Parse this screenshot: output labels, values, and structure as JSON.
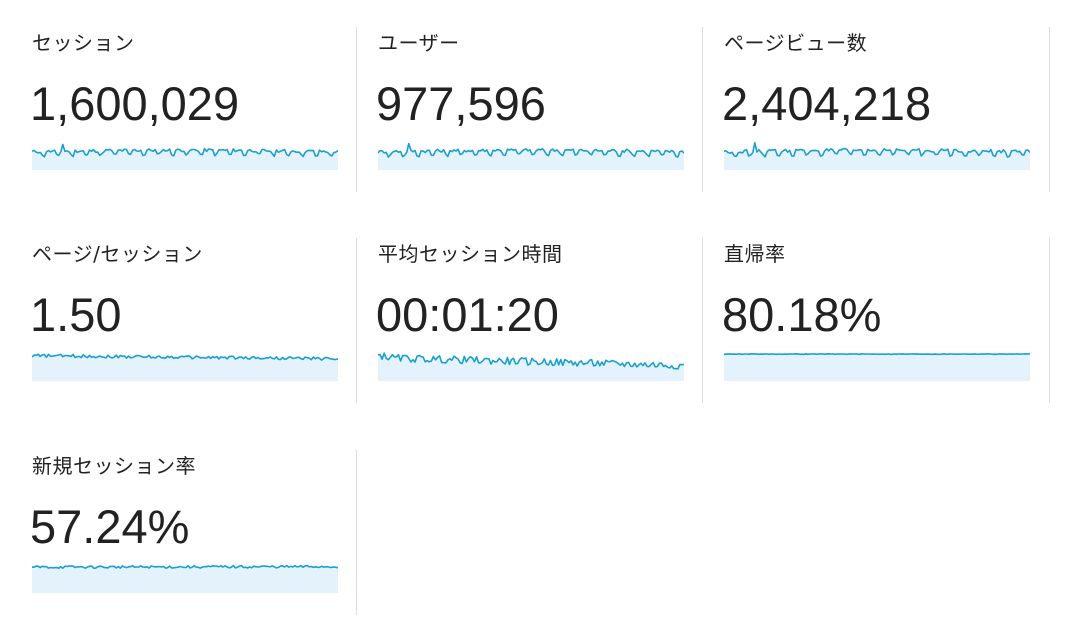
{
  "accent": "#1a9fd1",
  "fill": "#e4f3fb",
  "metrics": [
    {
      "label": "セッション",
      "value": "1,600,029",
      "trend": {
        "shape": "seasonal",
        "base": 0.45,
        "amp": 0.28,
        "spike": 0.12,
        "rise": 0.06
      }
    },
    {
      "label": "ユーザー",
      "value": "977,596",
      "trend": {
        "shape": "seasonal",
        "base": 0.45,
        "amp": 0.28,
        "spike": 0.12,
        "rise": 0.06
      }
    },
    {
      "label": "ページビュー数",
      "value": "2,404,218",
      "trend": {
        "shape": "seasonal",
        "base": 0.45,
        "amp": 0.28,
        "spike": 0.12,
        "rise": 0.06
      }
    },
    {
      "label": "ページ/セッション",
      "value": "1.50",
      "trend": {
        "shape": "flat-declining",
        "base": 0.86,
        "amp": 0.06,
        "spike": 0.0,
        "rise": -0.12
      }
    },
    {
      "label": "平均セッション時間",
      "value": "00:01:20",
      "trend": {
        "shape": "noisy-declining",
        "base": 0.78,
        "amp": 0.14,
        "spike": 0.1,
        "rise": -0.3
      }
    },
    {
      "label": "直帰率",
      "value": "80.18%",
      "trend": {
        "shape": "flat",
        "base": 0.92,
        "amp": 0.01,
        "spike": 0.0,
        "rise": 0.0
      }
    },
    {
      "label": "新規セッション率",
      "value": "57.24%",
      "trend": {
        "shape": "flat-wavy",
        "base": 0.88,
        "amp": 0.05,
        "spike": 0.0,
        "rise": 0.02
      }
    }
  ]
}
